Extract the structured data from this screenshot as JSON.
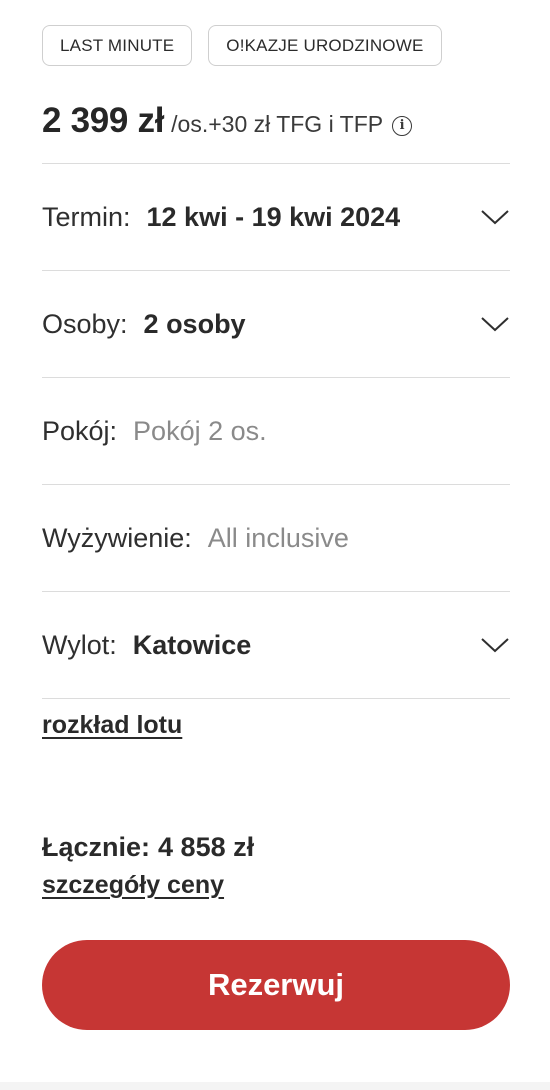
{
  "tags": [
    "LAST MINUTE",
    "O!KAZJE URODZINOWE"
  ],
  "price": {
    "main": "2 399 zł",
    "per": "/os.",
    "extra": "+30 zł TFG i TFP",
    "info_icon": "info-circle-icon"
  },
  "options": {
    "term": {
      "label": "Termin:",
      "value": "12 kwi - 19 kwi 2024",
      "icon": "chevron-down-icon"
    },
    "persons": {
      "label": "Osoby:",
      "value": "2 osoby",
      "icon": "chevron-down-icon"
    },
    "room": {
      "label": "Pokój:",
      "value": "Pokój 2 os."
    },
    "board": {
      "label": "Wyżywienie:",
      "value": "All inclusive"
    },
    "departure": {
      "label": "Wylot:",
      "value": "Katowice",
      "icon": "chevron-down-icon"
    }
  },
  "flight_schedule_link": "rozkład lotu",
  "total": {
    "label": "Łącznie:",
    "value": "4 858 zł"
  },
  "price_details_link": "szczegóły ceny",
  "cta_label": "Rezerwuj",
  "colors": {
    "accent": "#c63634",
    "divider": "#dcdcdc",
    "muted_text": "#8a8a8a"
  }
}
